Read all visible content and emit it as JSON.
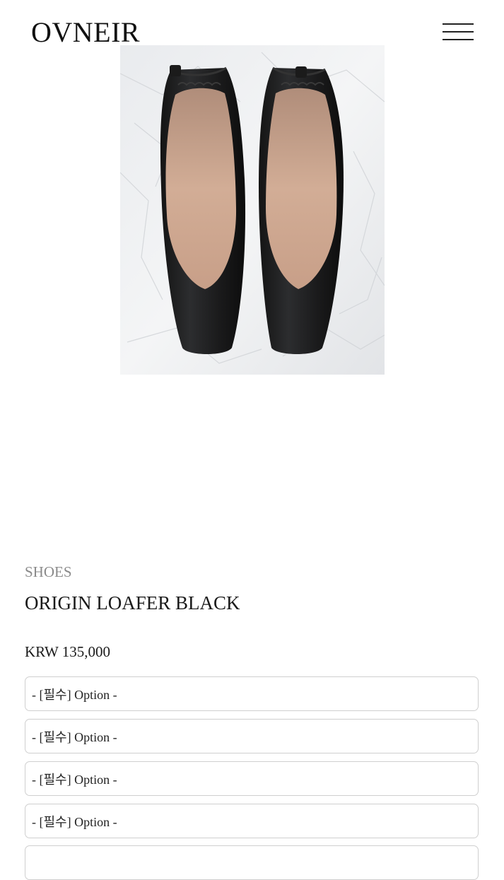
{
  "header": {
    "logo_text": "OVNEIR",
    "menu_icon": "hamburger-menu-icon"
  },
  "product": {
    "image_subject": "black leather square-toe loafers on crumpled white paper",
    "category": "SHOES",
    "name": "ORIGIN LOAFER BLACK",
    "price": "KRW 135,000"
  },
  "options": [
    {
      "label": "- [필수] Option -"
    },
    {
      "label": "- [필수] Option -"
    },
    {
      "label": "- [필수] Option -"
    },
    {
      "label": "- [필수] Option -"
    },
    {
      "label": ""
    }
  ],
  "colors": {
    "text": "#1a1a1a",
    "muted": "#8a8a8a",
    "border": "#cfcfcf",
    "background": "#ffffff"
  }
}
